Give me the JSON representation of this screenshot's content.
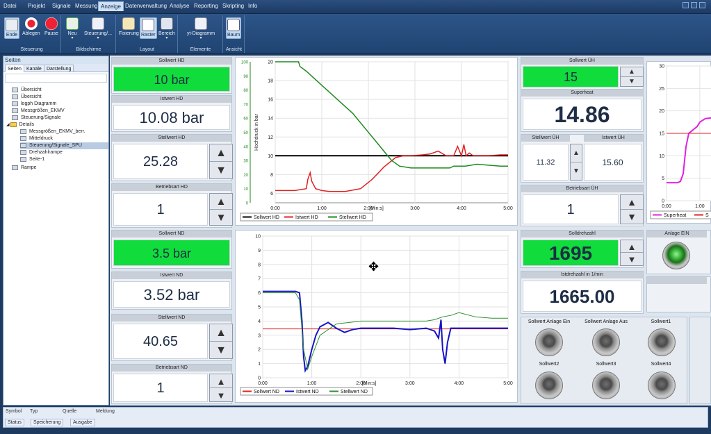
{
  "menubar": {
    "items": [
      "Datei",
      "Projekt",
      "Signale",
      "Messung",
      "Anzeige",
      "Datenverwaltung",
      "Analyse",
      "Reporting",
      "Skripting",
      "Info"
    ]
  },
  "ribbon": {
    "steuerung": {
      "label": "Steuerung",
      "buttons": [
        "Ende",
        "Ablegen",
        "Pause"
      ]
    },
    "bildschirme": {
      "label": "Bildschirme",
      "buttons": [
        "Neu",
        "Steuerung/..."
      ]
    },
    "layout": {
      "label": "Layout",
      "buttons": [
        "Fixierung",
        "Raster",
        "Bereich"
      ]
    },
    "elemente": {
      "label": "Elemente",
      "buttons": [
        "yt-Diagramm"
      ]
    },
    "ansicht": {
      "label": "Ansicht",
      "buttons": [
        "Baum"
      ]
    }
  },
  "sidebar": {
    "title": "Seiten",
    "tabs": [
      "Seiten",
      "Kanäle",
      "Darstellung"
    ],
    "items": [
      "Übersicht",
      "Übersicht",
      "logph Diagramm",
      "Messgrößen_EKMV",
      "Steuerung/Signale",
      "Details",
      "Messgrößen_EKMV_berr.",
      "Mitteldruck",
      "Steuerung/Signale_SPU",
      "Drehzahlrampe",
      "Seite-1",
      "Rampe"
    ]
  },
  "bottom": {
    "headers": [
      "Symbol",
      "Typ",
      "Quelle",
      "Meldung"
    ],
    "tabs": [
      "Status",
      "Speicherung",
      "Ausgabe"
    ]
  },
  "hd": {
    "sollwert_title": "Sollwert HD",
    "sollwert": "10 bar",
    "istwert_title": "Istwert HD",
    "istwert": "10.08 bar",
    "stellwert_title": "Stellwert HD",
    "stellwert": "25.28",
    "betriebsart_title": "Betriebsart HD",
    "betriebsart": "1"
  },
  "nd": {
    "sollwert_title": "Sollwert ND",
    "sollwert": "3.5 bar",
    "istwert_title": "Istwert ND",
    "istwert": "3.52 bar",
    "stellwert_title": "Stellwert ND",
    "stellwert": "40.65",
    "betriebsart_title": "Betriebsart ND",
    "betriebsart": "1"
  },
  "uh": {
    "sollwert_title": "Sollwert ÜH",
    "sollwert": "15",
    "superheat_title": "Superheat",
    "superheat": "14.86",
    "stellwert_title": "Stellwert ÜH",
    "stellwert": "11.32",
    "istwert_title": "Istwert ÜH",
    "istwert": "15.60",
    "betriebsart_title": "Betriebsart ÜH",
    "betriebsart": "1"
  },
  "drehzahl": {
    "soll_title": "Solldrehzahl",
    "soll": "1695",
    "ist_title": "Istdrehzahl in 1/min",
    "ist": "1665.00"
  },
  "anlage": {
    "title": "Anlage EIN"
  },
  "buttons": {
    "labels": [
      "Sollwert Anlage Ein",
      "Sollwert Anlage Aus",
      "Sollwert1",
      "Sollwert2",
      "Sollwert3",
      "Sollwert4"
    ]
  },
  "chart_data": [
    {
      "type": "line",
      "ylabel": "Hochdruck in bar",
      "xunit": "[Min:s]",
      "xticks": [
        "0:00",
        "1:00",
        "2:00",
        "3:00",
        "4:00",
        "5:00"
      ],
      "xlim": [
        0,
        300
      ],
      "yticks": [
        6,
        8,
        10,
        12,
        14,
        16,
        18,
        20
      ],
      "ylim": [
        5,
        20
      ],
      "ysec_ticks": [
        0,
        10,
        20,
        30,
        40,
        50,
        60,
        70,
        80,
        90,
        100
      ],
      "colors": [
        "#000000",
        "#e02020",
        "#1e8a1e"
      ],
      "series": [
        {
          "name": "Sollwert HD",
          "x": [
            0,
            300
          ],
          "y": [
            10,
            10
          ]
        },
        {
          "name": "Istwert HD",
          "x": [
            0,
            25,
            40,
            42,
            45,
            47,
            52,
            60,
            70,
            90,
            110,
            125,
            140,
            155,
            165,
            175,
            190,
            200,
            210,
            220,
            230,
            235,
            240,
            243,
            246,
            250,
            255,
            265,
            275,
            290,
            300
          ],
          "y": [
            6.3,
            6.3,
            6.5,
            7.5,
            8.2,
            7.3,
            6.5,
            6.3,
            6.2,
            6.2,
            6.5,
            7.5,
            8.8,
            9.8,
            10.0,
            10.0,
            10.1,
            10.2,
            10.5,
            10.0,
            10.0,
            11.0,
            10.0,
            11.2,
            10.0,
            10.3,
            10.0,
            10.0,
            10.0,
            10.1,
            10.1
          ]
        },
        {
          "name": "Stellwert HD",
          "x": [
            0,
            30,
            32,
            40,
            60,
            80,
            100,
            115,
            130,
            140,
            150,
            160,
            175,
            200,
            215,
            225,
            230,
            245,
            260,
            275,
            290,
            300
          ],
          "y": [
            20,
            20,
            19.5,
            19,
            17.5,
            16,
            14.5,
            13,
            11.5,
            10.5,
            9.5,
            8.9,
            8.7,
            8.7,
            8.7,
            8.7,
            8.9,
            8.9,
            9.1,
            9.0,
            8.9,
            8.9
          ]
        }
      ]
    },
    {
      "type": "line",
      "xunit": "[Min:s]",
      "xticks": [
        "0:00",
        "1:00",
        "2:00",
        "3:00",
        "4:00",
        "5:00"
      ],
      "xlim": [
        0,
        300
      ],
      "yticks": [
        0,
        1,
        2,
        3,
        4,
        5,
        6,
        7,
        8,
        9,
        10
      ],
      "ylim": [
        0,
        10
      ],
      "colors": [
        "#e02020",
        "#1414c8",
        "#2f8f2f"
      ],
      "series": [
        {
          "name": "Sollwert ND",
          "x": [
            0,
            300
          ],
          "y": [
            3.45,
            3.45
          ]
        },
        {
          "name": "Istwert ND",
          "x": [
            0,
            40,
            45,
            48,
            50,
            52,
            55,
            60,
            65,
            70,
            80,
            90,
            100,
            110,
            120,
            140,
            160,
            180,
            200,
            210,
            215,
            218,
            220,
            223,
            226,
            230,
            240,
            260,
            280,
            300
          ],
          "y": [
            6.1,
            6.1,
            6.0,
            4.0,
            1.5,
            0.5,
            0.8,
            2.0,
            3.0,
            3.6,
            3.9,
            3.5,
            3.2,
            3.4,
            3.5,
            3.5,
            3.5,
            3.4,
            3.5,
            3.3,
            2.8,
            4.1,
            2.0,
            1.0,
            2.5,
            3.5,
            3.5,
            3.5,
            3.5,
            3.5
          ]
        },
        {
          "name": "Stellwert ND",
          "x": [
            0,
            40,
            45,
            50,
            55,
            60,
            70,
            90,
            120,
            160,
            200,
            210,
            220,
            230,
            240,
            260,
            280,
            300
          ],
          "y": [
            6.0,
            6.0,
            5.5,
            2.0,
            0.6,
            1.5,
            3.0,
            3.8,
            4.0,
            4.0,
            4.0,
            4.1,
            4.3,
            4.4,
            4.6,
            4.3,
            4.2,
            4.2
          ]
        }
      ]
    },
    {
      "type": "line",
      "xticks": [
        "0:00",
        "1:00"
      ],
      "xlim": [
        0,
        85
      ],
      "yticks": [
        0,
        5,
        10,
        15,
        20,
        25,
        30
      ],
      "ylim": [
        0,
        30
      ],
      "colors": [
        "#e020e0",
        "#e02020"
      ],
      "series": [
        {
          "name": "Superheat",
          "x": [
            0,
            20,
            25,
            30,
            35,
            40,
            45,
            50,
            55,
            60,
            70,
            85
          ],
          "y": [
            4,
            4,
            4.3,
            6,
            12,
            15,
            15.5,
            16,
            16.5,
            17.5,
            18.3,
            18.5
          ]
        },
        {
          "name": "S",
          "x": [
            0,
            85
          ],
          "y": [
            15,
            15
          ]
        }
      ]
    }
  ]
}
